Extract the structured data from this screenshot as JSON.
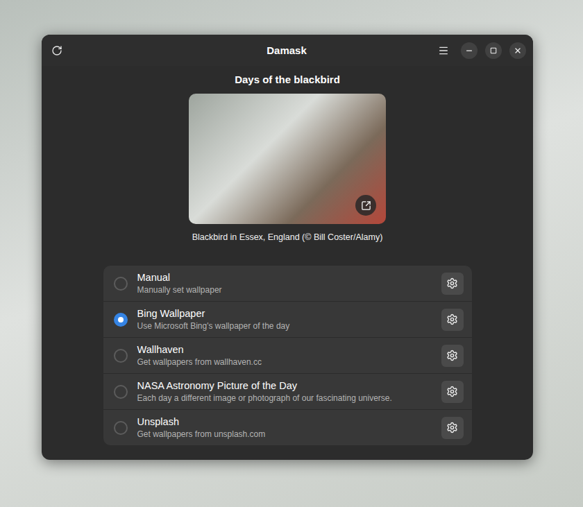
{
  "window": {
    "title": "Damask"
  },
  "wallpaper": {
    "title": "Days of the blackbird",
    "caption": "Blackbird in Essex, England (© Bill Coster/Alamy)"
  },
  "sources": [
    {
      "title": "Manual",
      "subtitle": "Manually set wallpaper",
      "selected": false
    },
    {
      "title": "Bing Wallpaper",
      "subtitle": "Use Microsoft Bing's wallpaper of the day",
      "selected": true
    },
    {
      "title": "Wallhaven",
      "subtitle": "Get wallpapers from wallhaven.cc",
      "selected": false
    },
    {
      "title": "NASA Astronomy Picture of the Day",
      "subtitle": "Each day a different image or photograph of our fascinating universe.",
      "selected": false
    },
    {
      "title": "Unsplash",
      "subtitle": "Get wallpapers from unsplash.com",
      "selected": false
    }
  ]
}
